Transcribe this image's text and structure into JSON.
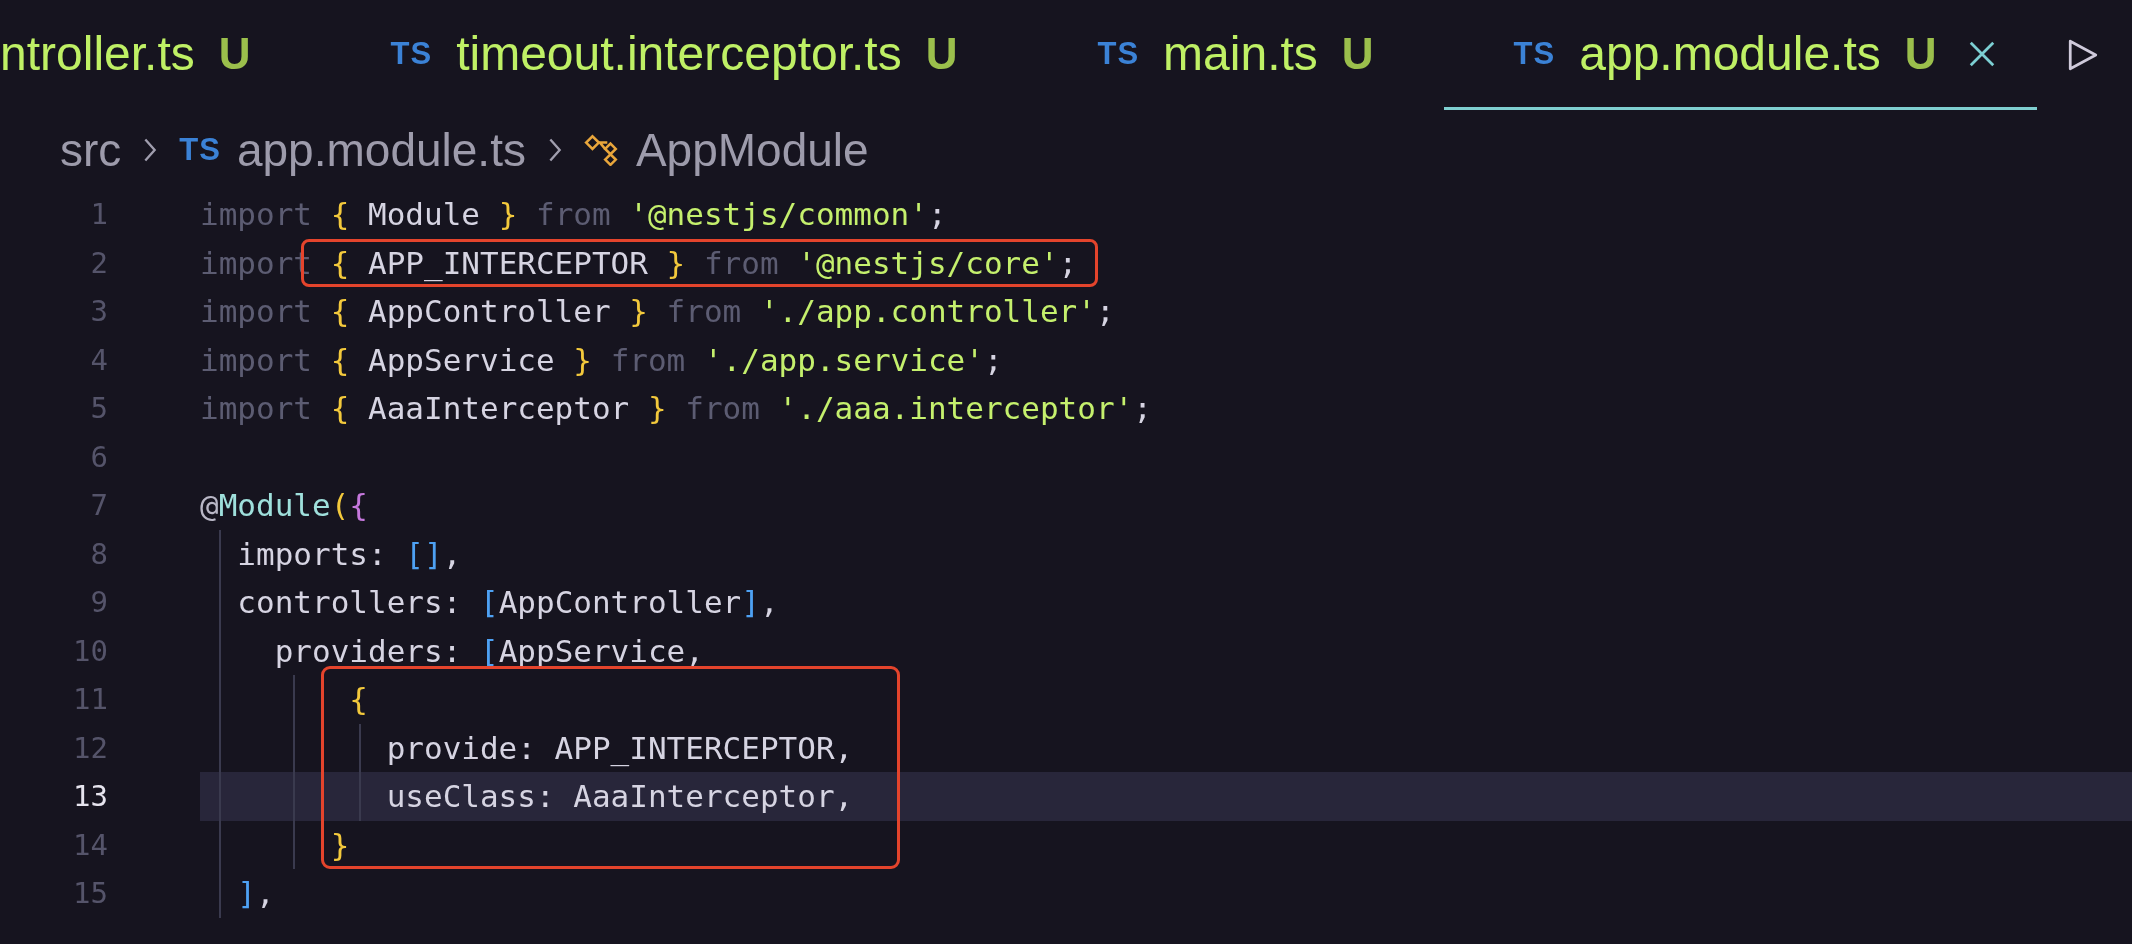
{
  "tabs": [
    {
      "label": "ntroller.ts",
      "status": "U",
      "selected": false
    },
    {
      "file_type": "TS",
      "label": "timeout.interceptor.ts",
      "status": "U",
      "selected": false
    },
    {
      "file_type": "TS",
      "label": "main.ts",
      "status": "U",
      "selected": false
    },
    {
      "file_type": "TS",
      "label": "app.module.ts",
      "status": "U",
      "selected": true
    }
  ],
  "breadcrumb": [
    {
      "kind": "folder",
      "label": "src"
    },
    {
      "kind": "file",
      "file_type": "TS",
      "label": "app.module.ts"
    },
    {
      "kind": "class",
      "label": "AppModule"
    }
  ],
  "lines": [
    {
      "number": "1",
      "current": false,
      "boxed": false,
      "tokens": [
        {
          "kind": "kw",
          "text": "import "
        },
        {
          "kind": "brace",
          "text": "{ "
        },
        {
          "kind": "ident",
          "text": "Module "
        },
        {
          "kind": "brace",
          "text": "} "
        },
        {
          "kind": "kw",
          "text": "from "
        },
        {
          "kind": "string",
          "text": "'@nestjs/common'"
        },
        {
          "kind": "punct",
          "text": ";"
        }
      ]
    },
    {
      "number": "2",
      "current": false,
      "boxed": false,
      "tokens": [
        {
          "kind": "kw",
          "text": "import "
        },
        {
          "kind": "brace",
          "text": "{ ",
          "boxed": true
        },
        {
          "kind": "ident",
          "text": "APP_INTERCEPTOR ",
          "boxed": true
        },
        {
          "kind": "brace",
          "text": "} ",
          "boxed": true
        },
        {
          "kind": "kw",
          "text": "from ",
          "boxed": true
        },
        {
          "kind": "string",
          "text": "'@nestjs/core'",
          "boxed": true
        },
        {
          "kind": "punct",
          "text": ";",
          "boxed": true
        }
      ]
    },
    {
      "number": "3",
      "current": false,
      "boxed": false,
      "tokens": [
        {
          "kind": "kw",
          "text": "import "
        },
        {
          "kind": "brace",
          "text": "{ "
        },
        {
          "kind": "ident",
          "text": "AppController "
        },
        {
          "kind": "brace",
          "text": "} "
        },
        {
          "kind": "kw",
          "text": "from "
        },
        {
          "kind": "string",
          "text": "'./app.controller'"
        },
        {
          "kind": "punct",
          "text": ";"
        }
      ]
    },
    {
      "number": "4",
      "current": false,
      "boxed": false,
      "tokens": [
        {
          "kind": "kw",
          "text": "import "
        },
        {
          "kind": "brace",
          "text": "{ "
        },
        {
          "kind": "ident",
          "text": "AppService "
        },
        {
          "kind": "brace",
          "text": "} "
        },
        {
          "kind": "kw",
          "text": "from "
        },
        {
          "kind": "string",
          "text": "'./app.service'"
        },
        {
          "kind": "punct",
          "text": ";"
        }
      ]
    },
    {
      "number": "5",
      "current": false,
      "boxed": false,
      "tokens": [
        {
          "kind": "kw",
          "text": "import "
        },
        {
          "kind": "brace",
          "text": "{ "
        },
        {
          "kind": "ident",
          "text": "AaaInterceptor "
        },
        {
          "kind": "brace",
          "text": "} "
        },
        {
          "kind": "kw",
          "text": "from "
        },
        {
          "kind": "string",
          "text": "'./aaa.interceptor'"
        },
        {
          "kind": "punct",
          "text": ";"
        }
      ]
    },
    {
      "number": "6",
      "current": false,
      "boxed": false
    },
    {
      "number": "7",
      "current": false,
      "boxed": false,
      "tokens": [
        {
          "kind": "at",
          "text": "@"
        },
        {
          "kind": "decorator",
          "text": "Module"
        },
        {
          "kind": "paren",
          "text": "("
        },
        {
          "kind": "brace2",
          "text": "{"
        }
      ]
    },
    {
      "number": "8",
      "current": false,
      "boxed": false,
      "tokens": [
        {
          "kind": "ident",
          "text": "  imports: "
        },
        {
          "kind": "bracket",
          "text": "[]"
        },
        {
          "kind": "punct",
          "text": ","
        }
      ]
    },
    {
      "number": "9",
      "current": false,
      "boxed": false,
      "tokens": [
        {
          "kind": "ident",
          "text": "  controllers: "
        },
        {
          "kind": "bracket",
          "text": "["
        },
        {
          "kind": "ident",
          "text": "AppController"
        },
        {
          "kind": "bracket",
          "text": "]"
        },
        {
          "kind": "punct",
          "text": ","
        }
      ]
    },
    {
      "number": "10",
      "current": false,
      "boxed": false,
      "tokens": [
        {
          "kind": "ident",
          "text": "    providers: "
        },
        {
          "kind": "bracket",
          "text": "["
        },
        {
          "kind": "ident",
          "text": "AppService,"
        }
      ]
    },
    {
      "number": "11",
      "current": false,
      "boxed": true,
      "tokens": [
        {
          "kind": "brace",
          "text": "        {"
        }
      ]
    },
    {
      "number": "12",
      "current": false,
      "boxed": true,
      "tokens": [
        {
          "kind": "ident",
          "text": "          provide: APP_INTERCEPTOR,"
        }
      ]
    },
    {
      "number": "13",
      "current": true,
      "boxed": true,
      "tokens": [
        {
          "kind": "ident",
          "text": "          useClass: AaaInterceptor,"
        }
      ]
    },
    {
      "number": "14",
      "current": false,
      "boxed": true,
      "tokens": [
        {
          "kind": "brace",
          "text": "       }"
        }
      ]
    },
    {
      "number": "15",
      "current": false,
      "boxed": false,
      "tokens": [
        {
          "kind": "bracket",
          "text": "  ]"
        },
        {
          "kind": "punct",
          "text": ","
        }
      ]
    }
  ]
}
